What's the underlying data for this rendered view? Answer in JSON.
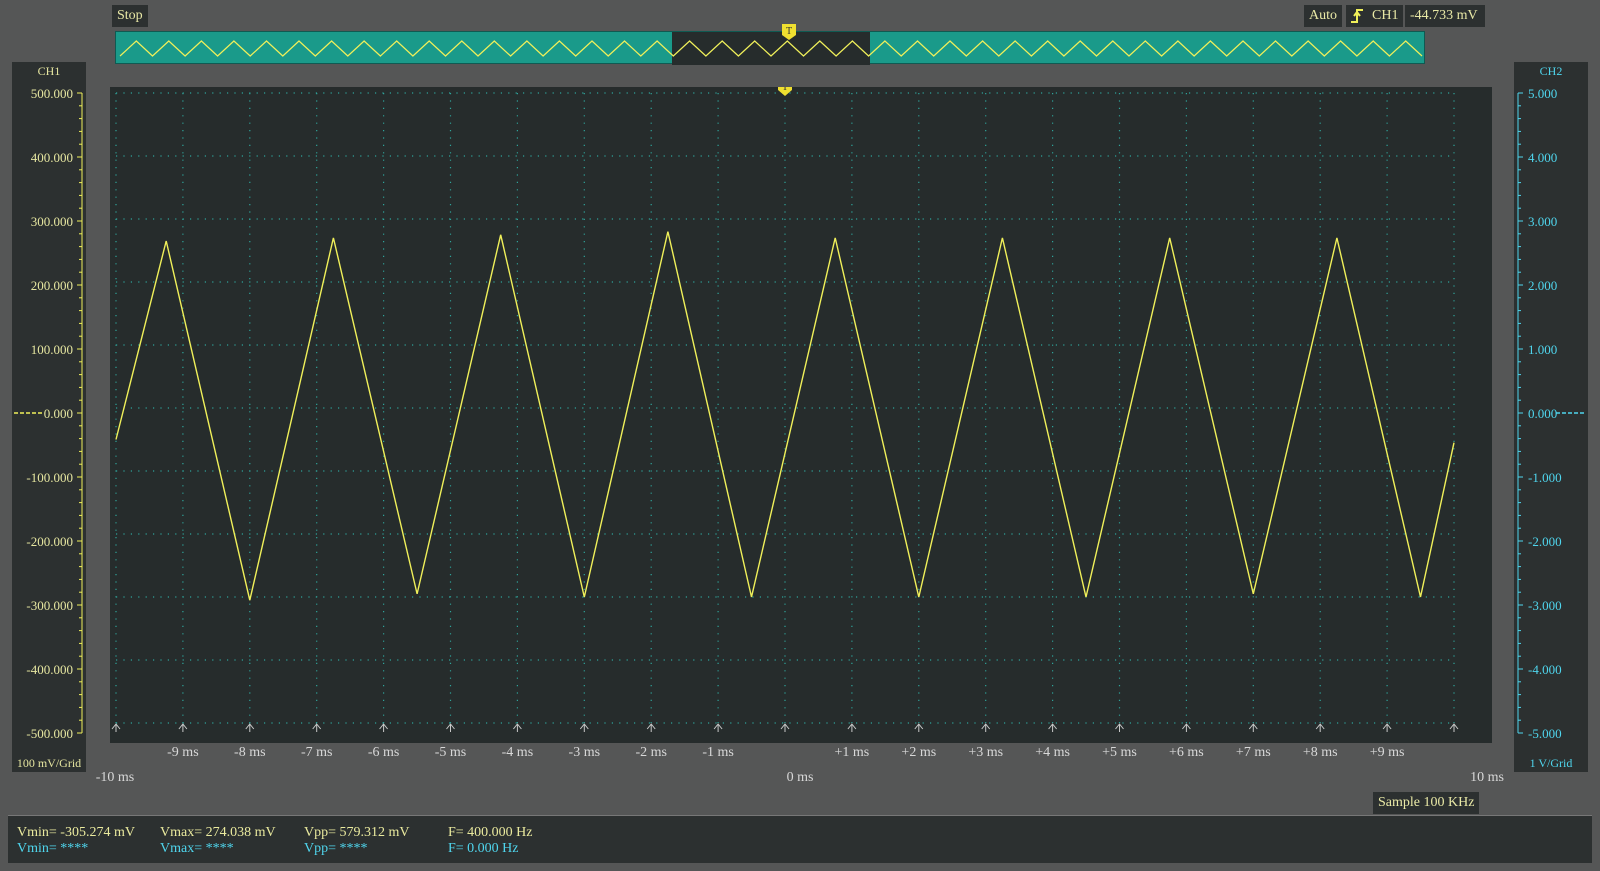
{
  "toolbar": {
    "run_state": "Stop",
    "trigger_mode": "Auto",
    "trigger_source": "CH1",
    "trigger_level": "-44.733 mV",
    "trigger_edge_icon": "rising-edge-icon"
  },
  "overview": {
    "trigger_marker": "T",
    "wave_color": "#f0f05a",
    "bg_color": "#1a9a8a",
    "window_color": "#262c2c"
  },
  "channels": {
    "ch1": {
      "label": "CH1",
      "scale": "100 mV/Grid",
      "color": "#f0f05a",
      "ticks": [
        "500.000",
        "400.000",
        "300.000",
        "200.000",
        "100.000",
        "0.000",
        "-100.000",
        "-200.000",
        "-300.000",
        "-400.000",
        "-500.000"
      ]
    },
    "ch2": {
      "label": "CH2",
      "scale": "1 V/Grid",
      "color": "#4fd6ee",
      "ticks": [
        "5.000",
        "4.000",
        "3.000",
        "2.000",
        "1.000",
        "0.000",
        "-1.000",
        "-2.000",
        "-3.000",
        "-4.000",
        "-5.000"
      ]
    }
  },
  "time_axis": {
    "labels": [
      "-9 ms",
      "-8 ms",
      "-7 ms",
      "-6 ms",
      "-5 ms",
      "-4 ms",
      "-3 ms",
      "-2 ms",
      "-1 ms",
      "+1 ms",
      "+2 ms",
      "+3 ms",
      "+4 ms",
      "+5 ms",
      "+6 ms",
      "+7 ms",
      "+8 ms",
      "+9 ms"
    ],
    "start": "-10 ms",
    "center": "0 ms",
    "end": "10 ms"
  },
  "plot": {
    "trigger_marker": "T"
  },
  "chart_data": {
    "type": "line",
    "x_unit": "ms",
    "y_unit": "mV",
    "xlim": [
      -10,
      10
    ],
    "ylim": [
      -500,
      500
    ],
    "grid": true,
    "series": [
      {
        "name": "CH1",
        "color": "#f0f05a",
        "x": [
          -10,
          -9.25,
          -8.0,
          -6.75,
          -5.5,
          -4.25,
          -3.0,
          -1.75,
          -0.5,
          0.75,
          2.0,
          3.25,
          4.5,
          5.75,
          7.0,
          8.25,
          9.5,
          10.0
        ],
        "y": [
          -50,
          265,
          -305,
          270,
          -295,
          275,
          -300,
          280,
          -300,
          270,
          -300,
          270,
          -300,
          270,
          -295,
          270,
          -300,
          -55
        ]
      }
    ]
  },
  "sample_rate": "Sample 100 KHz",
  "measurements": {
    "ch1": {
      "vmin": "Vmin= -305.274 mV",
      "vmax": "Vmax= 274.038 mV",
      "vpp": "Vpp= 579.312 mV",
      "freq": "F= 400.000 Hz"
    },
    "ch2": {
      "vmin": "Vmin= ****",
      "vmax": "Vmax= ****",
      "vpp": "Vpp= ****",
      "freq": "F= 0.000 Hz"
    }
  }
}
